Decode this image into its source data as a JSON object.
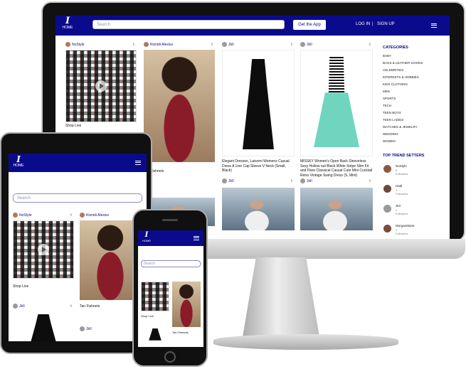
{
  "brand": {
    "logo_letter": "I",
    "home_label": "HOME"
  },
  "search": {
    "placeholder": "Search"
  },
  "nav": {
    "get_app_label": "Get the App",
    "login_label": "LOG IN",
    "separator": "|",
    "signup_label": "SIGN UP"
  },
  "feed": {
    "cards": [
      {
        "user": "NoStyle",
        "caption": ""
      },
      {
        "user": "Kinnidi Alexiss",
        "caption": ""
      },
      {
        "user": "JkII",
        "caption": "Elegant Dresses, Laisomi Womens Casual Dress A Line Cap Sleeve V Neck (Small, Black)"
      },
      {
        "user": "JkII",
        "caption": "MISSKY Women's Open Back Sleeveless Sexy Hollow out Black White Stripe Slim Fit and Flare Classical Casual Cute Mini Cocktail Retro Vintage Swing Dress (S, Mint)"
      }
    ],
    "row2_users": [
      "JkII",
      "JkII"
    ]
  },
  "sidebar": {
    "categories_title": "CATEGORIES",
    "categories": [
      "BABY",
      "BAGS & LEATHER GOODS",
      "CELEBRITIES",
      "INTERESTS & HOBBIES",
      "KIDS CLOTHING",
      "MEN",
      "SPORTS",
      "TECH",
      "TEEN BOYS",
      "TEEN LADIES",
      "WATCHES & JEWELRY",
      "WEDDING",
      "WOMEN"
    ],
    "trend_title": "TOP TREND SETTERS",
    "trend_setters": [
      {
        "name": "NoStyle",
        "count": "0",
        "label": "Followers"
      },
      {
        "name": "Hadi",
        "count": "1",
        "label": "Followers"
      },
      {
        "name": "JkII",
        "count": "1",
        "label": "Followers"
      },
      {
        "name": "MorganMarie",
        "count": "1",
        "label": "Followers"
      }
    ]
  },
  "tablet": {
    "cards": [
      {
        "user": "NoStyle",
        "caption": "Shop Live"
      },
      {
        "user": "Kinnidi Alexiss",
        "caption": "Tan Fishnets"
      },
      {
        "user": "JkII",
        "caption": ""
      },
      {
        "user": "JkII",
        "caption": ""
      }
    ]
  },
  "phone": {
    "cards": [
      {
        "caption": "Shop Live"
      },
      {
        "caption": "Tan Fishnets"
      }
    ]
  },
  "monitor_partial": {
    "shop_live": "Shop Live",
    "tan_fishnets": "Tan Fishnets"
  }
}
